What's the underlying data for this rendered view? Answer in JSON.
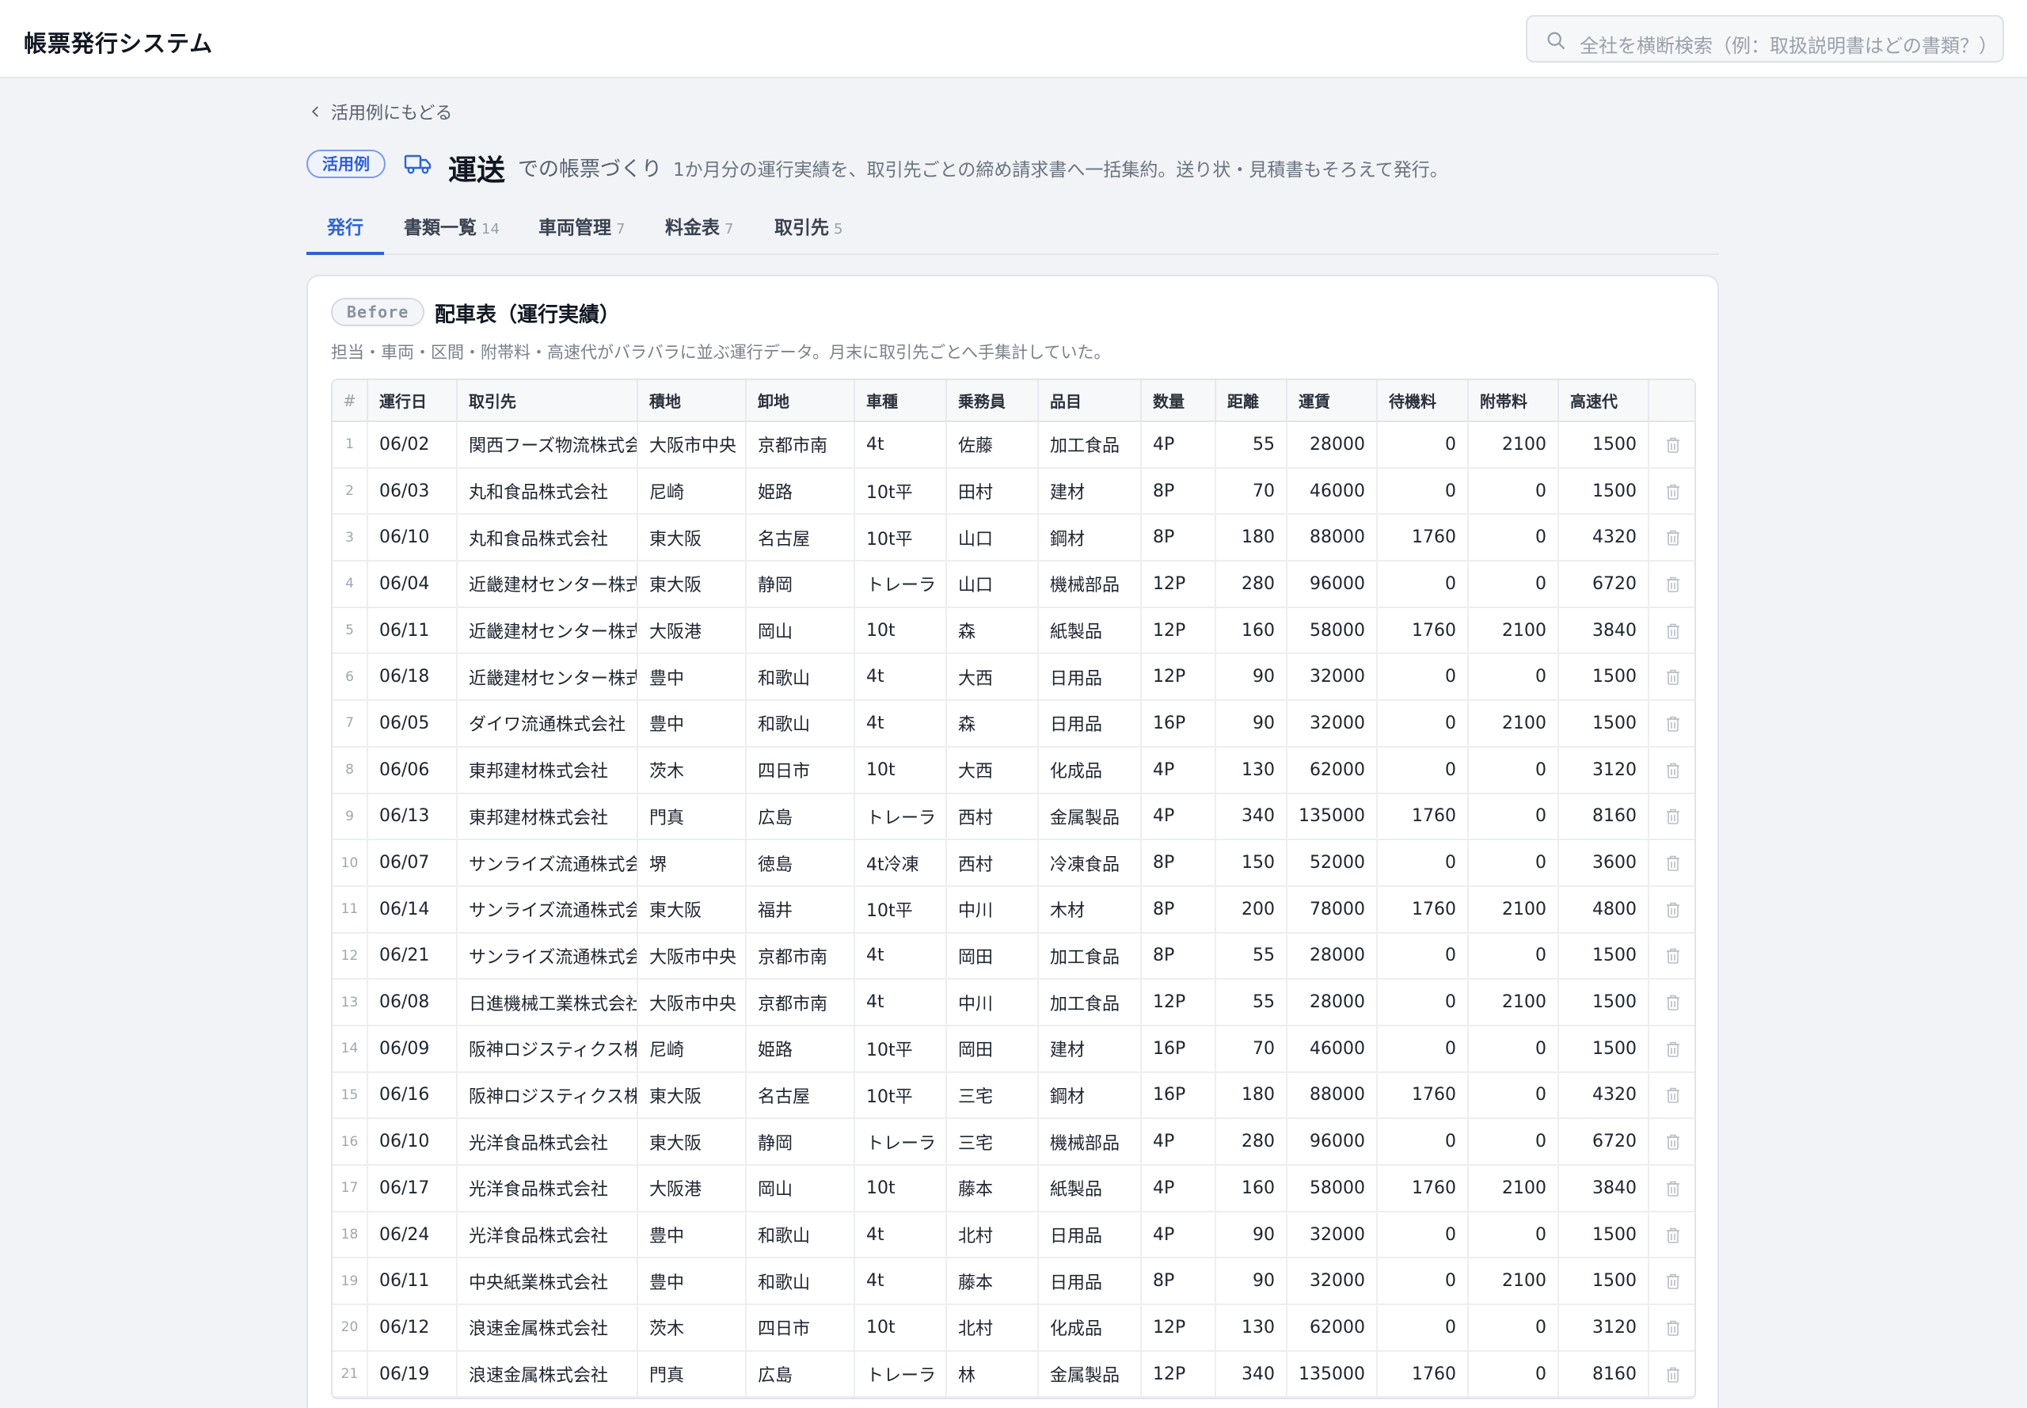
{
  "app": {
    "title": "帳票発行システム"
  },
  "search": {
    "placeholder": "全社を横断検索（例：取扱説明書はどの書類？）"
  },
  "back_link": "活用例にもどる",
  "heading": {
    "badge": "活用例",
    "icon": "truck-icon",
    "title": "運送",
    "subtitle": "での帳票づくり",
    "description": "1か月分の運行実績を、取引先ごとの締め請求書へ一括集約。送り状・見積書もそろえて発行。"
  },
  "tabs": [
    {
      "label": "発行",
      "count": "",
      "active": true
    },
    {
      "label": "書類一覧",
      "count": "14",
      "active": false
    },
    {
      "label": "車両管理",
      "count": "7",
      "active": false
    },
    {
      "label": "料金表",
      "count": "7",
      "active": false
    },
    {
      "label": "取引先",
      "count": "5",
      "active": false
    }
  ],
  "card": {
    "pill": "Before",
    "title": "配車表（運行実績）",
    "description": "担当・車両・区間・附帯料・高速代がバラバラに並ぶ運行データ。月末に取引先ごとへ手集計していた。"
  },
  "table": {
    "headers": [
      "#",
      "運行日",
      "取引先",
      "積地",
      "卸地",
      "車種",
      "乗務員",
      "品目",
      "数量",
      "距離",
      "運賃",
      "待機料",
      "附帯料",
      "高速代"
    ],
    "rows": [
      [
        "1",
        "06/02",
        "関西フーズ物流株式会社",
        "大阪市中央",
        "京都市南",
        "4t",
        "佐藤",
        "加工食品",
        "4P",
        "55",
        "28000",
        "0",
        "2100",
        "1500"
      ],
      [
        "2",
        "06/03",
        "丸和食品株式会社",
        "尼崎",
        "姫路",
        "10t平",
        "田村",
        "建材",
        "8P",
        "70",
        "46000",
        "0",
        "0",
        "1500"
      ],
      [
        "3",
        "06/10",
        "丸和食品株式会社",
        "東大阪",
        "名古屋",
        "10t平",
        "山口",
        "鋼材",
        "8P",
        "180",
        "88000",
        "1760",
        "0",
        "4320"
      ],
      [
        "4",
        "06/04",
        "近畿建材センター株式会社",
        "東大阪",
        "静岡",
        "トレーラ",
        "山口",
        "機械部品",
        "12P",
        "280",
        "96000",
        "0",
        "0",
        "6720"
      ],
      [
        "5",
        "06/11",
        "近畿建材センター株式会社",
        "大阪港",
        "岡山",
        "10t",
        "森",
        "紙製品",
        "12P",
        "160",
        "58000",
        "1760",
        "2100",
        "3840"
      ],
      [
        "6",
        "06/18",
        "近畿建材センター株式会社",
        "豊中",
        "和歌山",
        "4t",
        "大西",
        "日用品",
        "12P",
        "90",
        "32000",
        "0",
        "0",
        "1500"
      ],
      [
        "7",
        "06/05",
        "ダイワ流通株式会社",
        "豊中",
        "和歌山",
        "4t",
        "森",
        "日用品",
        "16P",
        "90",
        "32000",
        "0",
        "2100",
        "1500"
      ],
      [
        "8",
        "06/06",
        "東邦建材株式会社",
        "茨木",
        "四日市",
        "10t",
        "大西",
        "化成品",
        "4P",
        "130",
        "62000",
        "0",
        "0",
        "3120"
      ],
      [
        "9",
        "06/13",
        "東邦建材株式会社",
        "門真",
        "広島",
        "トレーラ",
        "西村",
        "金属製品",
        "4P",
        "340",
        "135000",
        "1760",
        "0",
        "8160"
      ],
      [
        "10",
        "06/07",
        "サンライズ流通株式会社",
        "堺",
        "徳島",
        "4t冷凍",
        "西村",
        "冷凍食品",
        "8P",
        "150",
        "52000",
        "0",
        "0",
        "3600"
      ],
      [
        "11",
        "06/14",
        "サンライズ流通株式会社",
        "東大阪",
        "福井",
        "10t平",
        "中川",
        "木材",
        "8P",
        "200",
        "78000",
        "1760",
        "2100",
        "4800"
      ],
      [
        "12",
        "06/21",
        "サンライズ流通株式会社",
        "大阪市中央",
        "京都市南",
        "4t",
        "岡田",
        "加工食品",
        "8P",
        "55",
        "28000",
        "0",
        "0",
        "1500"
      ],
      [
        "13",
        "06/08",
        "日進機械工業株式会社",
        "大阪市中央",
        "京都市南",
        "4t",
        "中川",
        "加工食品",
        "12P",
        "55",
        "28000",
        "0",
        "2100",
        "1500"
      ],
      [
        "14",
        "06/09",
        "阪神ロジスティクス株式会社",
        "尼崎",
        "姫路",
        "10t平",
        "岡田",
        "建材",
        "16P",
        "70",
        "46000",
        "0",
        "0",
        "1500"
      ],
      [
        "15",
        "06/16",
        "阪神ロジスティクス株式会社",
        "東大阪",
        "名古屋",
        "10t平",
        "三宅",
        "鋼材",
        "16P",
        "180",
        "88000",
        "1760",
        "0",
        "4320"
      ],
      [
        "16",
        "06/10",
        "光洋食品株式会社",
        "東大阪",
        "静岡",
        "トレーラ",
        "三宅",
        "機械部品",
        "4P",
        "280",
        "96000",
        "0",
        "0",
        "6720"
      ],
      [
        "17",
        "06/17",
        "光洋食品株式会社",
        "大阪港",
        "岡山",
        "10t",
        "藤本",
        "紙製品",
        "4P",
        "160",
        "58000",
        "1760",
        "2100",
        "3840"
      ],
      [
        "18",
        "06/24",
        "光洋食品株式会社",
        "豊中",
        "和歌山",
        "4t",
        "北村",
        "日用品",
        "4P",
        "90",
        "32000",
        "0",
        "0",
        "1500"
      ],
      [
        "19",
        "06/11",
        "中央紙業株式会社",
        "豊中",
        "和歌山",
        "4t",
        "藤本",
        "日用品",
        "8P",
        "90",
        "32000",
        "0",
        "2100",
        "1500"
      ],
      [
        "20",
        "06/12",
        "浪速金属株式会社",
        "茨木",
        "四日市",
        "10t",
        "北村",
        "化成品",
        "12P",
        "130",
        "62000",
        "0",
        "0",
        "3120"
      ],
      [
        "21",
        "06/19",
        "浪速金属株式会社",
        "門真",
        "広島",
        "トレーラ",
        "林",
        "金属製品",
        "12P",
        "340",
        "135000",
        "1760",
        "0",
        "8160"
      ]
    ]
  }
}
